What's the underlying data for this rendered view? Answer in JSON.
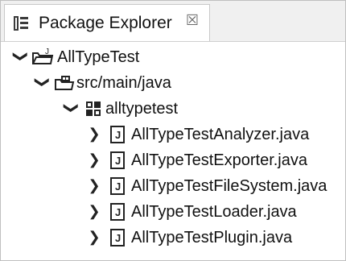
{
  "tab": {
    "title": "Package Explorer",
    "icon": "package-explorer-icon",
    "close_glyph": "☒"
  },
  "tree": {
    "project": {
      "label": "AllTypeTest",
      "icon": "java-project-folder-icon",
      "expanded": true
    },
    "source_folder": {
      "label": "src/main/java",
      "icon": "source-folder-icon",
      "expanded": true
    },
    "package": {
      "label": "alltypetest",
      "icon": "package-icon",
      "expanded": true
    },
    "files": [
      {
        "label": "AllTypeTestAnalyzer.java",
        "icon": "java-file-icon"
      },
      {
        "label": "AllTypeTestExporter.java",
        "icon": "java-file-icon"
      },
      {
        "label": "AllTypeTestFileSystem.java",
        "icon": "java-file-icon"
      },
      {
        "label": "AllTypeTestLoader.java",
        "icon": "java-file-icon"
      },
      {
        "label": "AllTypeTestPlugin.java",
        "icon": "java-file-icon"
      }
    ]
  },
  "glyphs": {
    "expanded": "❯",
    "collapsed": "❯"
  }
}
